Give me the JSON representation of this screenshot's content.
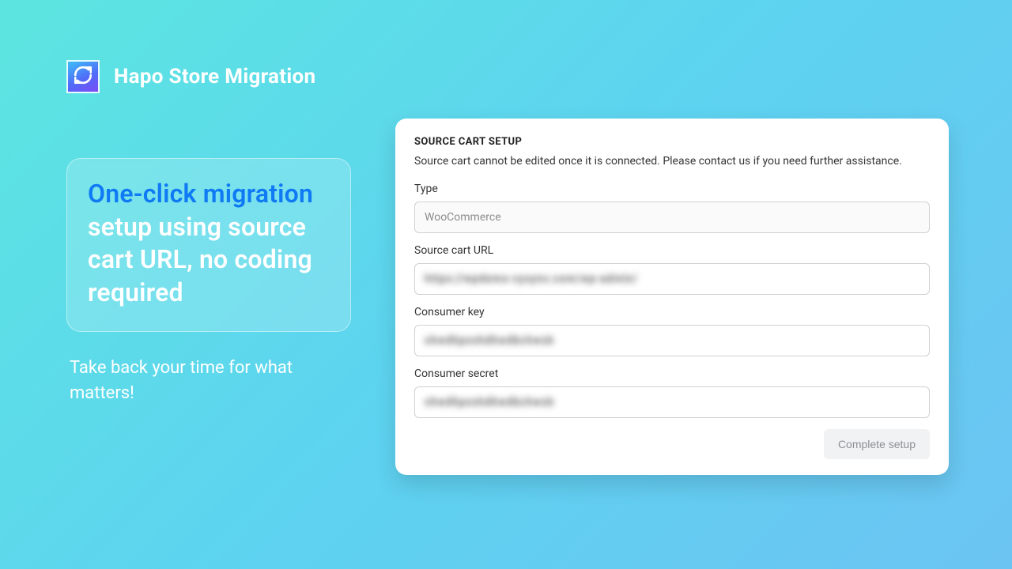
{
  "brand": {
    "title": "Hapo Store Migration"
  },
  "hero": {
    "line1a": "One-click",
    "line1b": "migration",
    "line2": "setup using source cart URL, no coding required"
  },
  "tagline": "Take back your time for what matters!",
  "form": {
    "heading": "Source Cart Setup",
    "help": "Source cart cannot be edited once it is connected. Please contact us if you need further assistance.",
    "type_label": "Type",
    "type_value": "WooCommerce",
    "url_label": "Source cart URL",
    "url_value_masked": "https://wpdemo-cysync.com/wp-admin/",
    "key_label": "Consumer key",
    "key_value_masked": "shwdhposhdhwdbchwsb",
    "secret_label": "Consumer secret",
    "secret_value_masked": "shwdhposhdhwdbchwsb",
    "submit_label": "Complete setup"
  }
}
